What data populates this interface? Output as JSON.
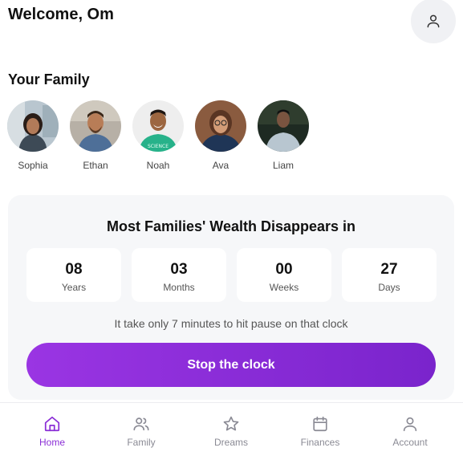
{
  "header": {
    "welcome": "Welcome, Om",
    "account_icon": "user-icon"
  },
  "family": {
    "title": "Your Family",
    "members": [
      {
        "name": "Sophia"
      },
      {
        "name": "Ethan"
      },
      {
        "name": "Noah"
      },
      {
        "name": "Ava"
      },
      {
        "name": "Liam"
      }
    ]
  },
  "countdown": {
    "title": "Most Families' Wealth Disappears in",
    "units": [
      {
        "value": "08",
        "label": "Years"
      },
      {
        "value": "03",
        "label": "Months"
      },
      {
        "value": "00",
        "label": "Weeks"
      },
      {
        "value": "27",
        "label": "Days"
      }
    ],
    "subtitle": "It take only 7 minutes to hit pause on that clock",
    "cta": "Stop the clock"
  },
  "nav": {
    "items": [
      {
        "label": "Home",
        "icon": "home-icon",
        "active": true
      },
      {
        "label": "Family",
        "icon": "family-icon",
        "active": false
      },
      {
        "label": "Dreams",
        "icon": "star-icon",
        "active": false
      },
      {
        "label": "Finances",
        "icon": "calendar-icon",
        "active": false
      },
      {
        "label": "Account",
        "icon": "user-icon",
        "active": false
      }
    ]
  },
  "colors": {
    "accent": "#8b2fd6",
    "card_bg": "#f6f7f9",
    "muted": "#8a8a94"
  }
}
